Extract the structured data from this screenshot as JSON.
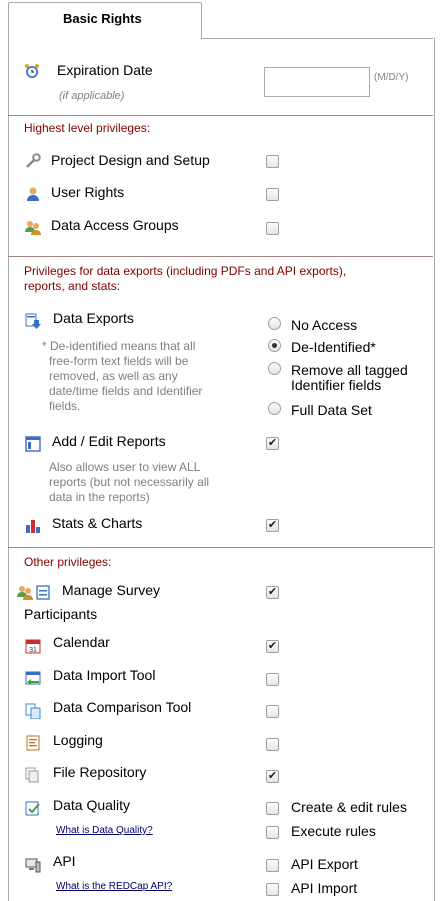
{
  "tab": {
    "label": "Basic Rights"
  },
  "expiration": {
    "label": "Expiration Date",
    "note": "(if applicable)",
    "value": "",
    "format": "(M/D/Y)"
  },
  "highest": {
    "title": "Highest level privileges:",
    "items": [
      {
        "label": "Project Design and Setup",
        "checked": false
      },
      {
        "label": "User Rights",
        "checked": false
      },
      {
        "label": "Data Access Groups",
        "checked": false
      }
    ]
  },
  "exports": {
    "title_line1": "Privileges for data exports (including PDFs and API exports),",
    "title_line2": "reports, and stats:",
    "data_exports": {
      "label": "Data Exports",
      "note": [
        "* De-identified means that all",
        "free-form text fields will be",
        "removed, as well as any",
        "date/time fields and Identifier",
        "fields."
      ],
      "options": [
        "No Access",
        "De-Identified*",
        "Remove all tagged",
        "Identifier fields",
        "Full Data Set"
      ],
      "selected": "De-Identified*"
    },
    "reports": {
      "label": "Add / Edit Reports",
      "checked": true,
      "note": [
        "Also allows user to view ALL",
        "reports (but not necessarily all",
        "data in the reports)"
      ]
    },
    "stats": {
      "label": "Stats & Charts",
      "checked": true
    }
  },
  "other": {
    "title": "Other privileges:",
    "survey": {
      "label_line1": "Manage Survey",
      "label_line2": "Participants",
      "checked": true
    },
    "calendar": {
      "label": "Calendar",
      "checked": true
    },
    "import": {
      "label": "Data Import Tool",
      "checked": false
    },
    "comparison": {
      "label": "Data Comparison Tool",
      "checked": false
    },
    "logging": {
      "label": "Logging",
      "checked": false
    },
    "files": {
      "label": "File Repository",
      "checked": true
    },
    "quality": {
      "label": "Data Quality",
      "link": "What is Data Quality?",
      "options": [
        "Create & edit rules",
        "Execute rules"
      ]
    },
    "api": {
      "label": "API",
      "link": "What is the REDCap API?",
      "options": [
        "API Export",
        "API Import"
      ]
    }
  },
  "checkmark": "✔"
}
